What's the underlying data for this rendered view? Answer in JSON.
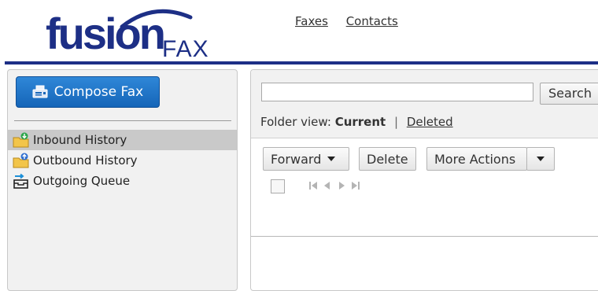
{
  "brand": {
    "name_main": "fusion",
    "name_sub": "FAX",
    "color": "#1d2f86"
  },
  "topnav": [
    {
      "label": "Faxes"
    },
    {
      "label": "Contacts"
    }
  ],
  "sidebar": {
    "compose_label": "Compose Fax",
    "compose_color": "#1a6fc6",
    "folders": [
      {
        "label": "Inbound History",
        "icon": "inbound-folder-icon",
        "active": true
      },
      {
        "label": "Outbound History",
        "icon": "outbound-folder-icon",
        "active": false
      },
      {
        "label": "Outgoing Queue",
        "icon": "outgoing-queue-icon",
        "active": false
      }
    ]
  },
  "main": {
    "search": {
      "value": "",
      "placeholder": "",
      "button_label": "Search"
    },
    "folder_view": {
      "prefix": "Folder view:",
      "current": "Current",
      "separator": "|",
      "deleted": "Deleted"
    },
    "toolbar": {
      "forward_label": "Forward",
      "delete_label": "Delete",
      "more_actions_label": "More Actions"
    }
  }
}
